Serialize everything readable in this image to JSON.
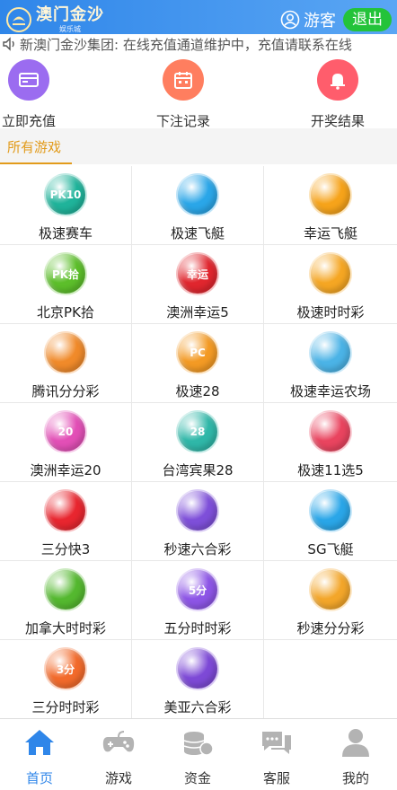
{
  "header": {
    "logo_main": "澳门金沙",
    "logo_sub": "娱乐城",
    "guest_label": "游客",
    "logout_label": "退出"
  },
  "notice": {
    "text": "新澳门金沙集团: 在线充值通道维护中，充值请联系在线"
  },
  "quick_actions": [
    {
      "label": "立即充值",
      "icon": "wallet-icon",
      "color": "#9b6cf0"
    },
    {
      "label": "下注记录",
      "icon": "calendar-icon",
      "color": "#ff7e5f"
    },
    {
      "label": "开奖结果",
      "icon": "bell-icon",
      "color": "#ff5d6c"
    }
  ],
  "section": {
    "title": "所有游戏"
  },
  "games": [
    {
      "name": "极速赛车",
      "badge": "PK10",
      "color": "#1fb39a"
    },
    {
      "name": "极速飞艇",
      "badge": "",
      "color": "#2aa6e8"
    },
    {
      "name": "幸运飞艇",
      "badge": "",
      "color": "#f6a31a"
    },
    {
      "name": "北京PK拾",
      "badge": "PK拾",
      "color": "#5cbe2a"
    },
    {
      "name": "澳洲幸运5",
      "badge": "幸运",
      "color": "#e0262e"
    },
    {
      "name": "极速时时彩",
      "badge": "",
      "color": "#f5a623"
    },
    {
      "name": "腾讯分分彩",
      "badge": "",
      "color": "#f08a2a"
    },
    {
      "name": "极速28",
      "badge": "PC",
      "color": "#f39a24"
    },
    {
      "name": "极速幸运农场",
      "badge": "",
      "color": "#4bb3e6"
    },
    {
      "name": "澳洲幸运20",
      "badge": "20",
      "color": "#e24fb6"
    },
    {
      "name": "台湾宾果28",
      "badge": "28",
      "color": "#2fb7a8"
    },
    {
      "name": "极速11选5",
      "badge": "",
      "color": "#e9445f"
    },
    {
      "name": "三分快3",
      "badge": "",
      "color": "#e8262f"
    },
    {
      "name": "秒速六合彩",
      "badge": "",
      "color": "#7e4fd9"
    },
    {
      "name": "SG飞艇",
      "badge": "",
      "color": "#2aa6e8"
    },
    {
      "name": "加拿大时时彩",
      "badge": "",
      "color": "#54b82f"
    },
    {
      "name": "五分时时彩",
      "badge": "5分",
      "color": "#8d55e6"
    },
    {
      "name": "秒速分分彩",
      "badge": "",
      "color": "#f3a62a"
    },
    {
      "name": "三分时时彩",
      "badge": "3分",
      "color": "#f26a2b"
    },
    {
      "name": "美亚六合彩",
      "badge": "",
      "color": "#7d49d6"
    }
  ],
  "bottom_nav": [
    {
      "label": "首页",
      "icon": "home-icon",
      "active": true
    },
    {
      "label": "游戏",
      "icon": "gamepad-icon",
      "active": false
    },
    {
      "label": "资金",
      "icon": "coins-icon",
      "active": false
    },
    {
      "label": "客服",
      "icon": "chat-icon",
      "active": false
    },
    {
      "label": "我的",
      "icon": "user-icon",
      "active": false
    }
  ],
  "colors": {
    "header_start": "#2f86e9",
    "header_end": "#5aa6f4",
    "logout_bg": "#23c33a",
    "section_accent": "#e29b1b",
    "nav_active": "#2f86e9",
    "nav_inactive": "#b3b3b3"
  }
}
